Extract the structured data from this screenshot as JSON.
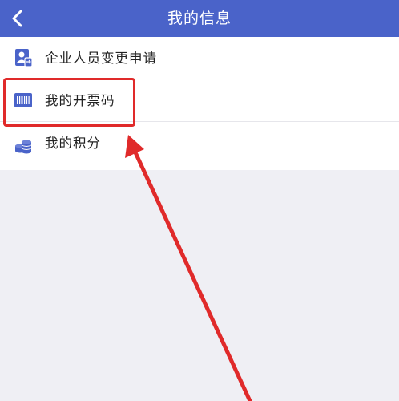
{
  "header": {
    "title": "我的信息",
    "background_color": "#4a63c9",
    "back_icon": "chevron-left-icon"
  },
  "menu": {
    "items": [
      {
        "label": "企业人员变更申请",
        "icon": "person-change-icon"
      },
      {
        "label": "我的开票码",
        "icon": "barcode-icon"
      },
      {
        "label": "我的积分",
        "icon": "coins-icon"
      }
    ]
  },
  "annotation": {
    "highlight_color": "#e02a2a",
    "highlighted_item": "我的开票码"
  }
}
